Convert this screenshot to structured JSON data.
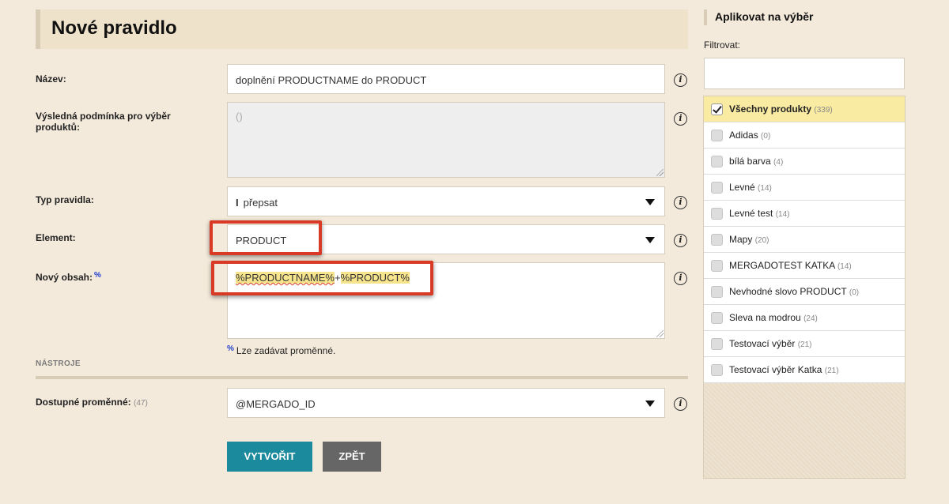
{
  "header": {
    "title": "Nové pravidlo"
  },
  "form": {
    "name": {
      "label": "Název:",
      "value": "doplnění PRODUCTNAME do PRODUCT"
    },
    "condition": {
      "label": "Výsledná podmínka pro výběr produktů:",
      "value": "()"
    },
    "rule_type": {
      "label": "Typ pravidla:",
      "value": "přepsat"
    },
    "element": {
      "label": "Element:",
      "value": "PRODUCT"
    },
    "new_content": {
      "label": "Nový obsah:",
      "marker": "%",
      "value_part1": "%PRODUCTNAME%",
      "value_sep": "+",
      "value_part2": "%PRODUCT%"
    },
    "hint": {
      "marker": "%",
      "text": "Lze zadávat proměnné."
    },
    "tools_section": "NÁSTROJE",
    "variables": {
      "label": "Dostupné proměnné:",
      "count": "(47)",
      "value": "@MERGADO_ID"
    },
    "info_icon_glyph": "i"
  },
  "buttons": {
    "create": "VYTVOŘIT",
    "back": "ZPĚT"
  },
  "sidebar": {
    "title": "Aplikovat na výběr",
    "filter_label": "Filtrovat:",
    "items": [
      {
        "label": "Všechny produkty",
        "count": "(339)",
        "checked": true
      },
      {
        "label": "Adidas",
        "count": "(0)",
        "checked": false
      },
      {
        "label": "bílá barva",
        "count": "(4)",
        "checked": false
      },
      {
        "label": "Levné",
        "count": "(14)",
        "checked": false
      },
      {
        "label": "Levné test",
        "count": "(14)",
        "checked": false
      },
      {
        "label": "Mapy",
        "count": "(20)",
        "checked": false
      },
      {
        "label": "MERGADOTEST KATKA",
        "count": "(14)",
        "checked": false
      },
      {
        "label": "Nevhodné slovo PRODUCT",
        "count": "(0)",
        "checked": false
      },
      {
        "label": "Sleva na modrou",
        "count": "(24)",
        "checked": false
      },
      {
        "label": "Testovací výběr",
        "count": "(21)",
        "checked": false
      },
      {
        "label": "Testovací výběr Katka",
        "count": "(21)",
        "checked": false
      }
    ]
  },
  "colors": {
    "primary_button": "#1b8a9c",
    "secondary_button": "#666666",
    "highlight_border": "#d83a26",
    "active_item": "#f9eba2",
    "background": "#f4eadb"
  }
}
